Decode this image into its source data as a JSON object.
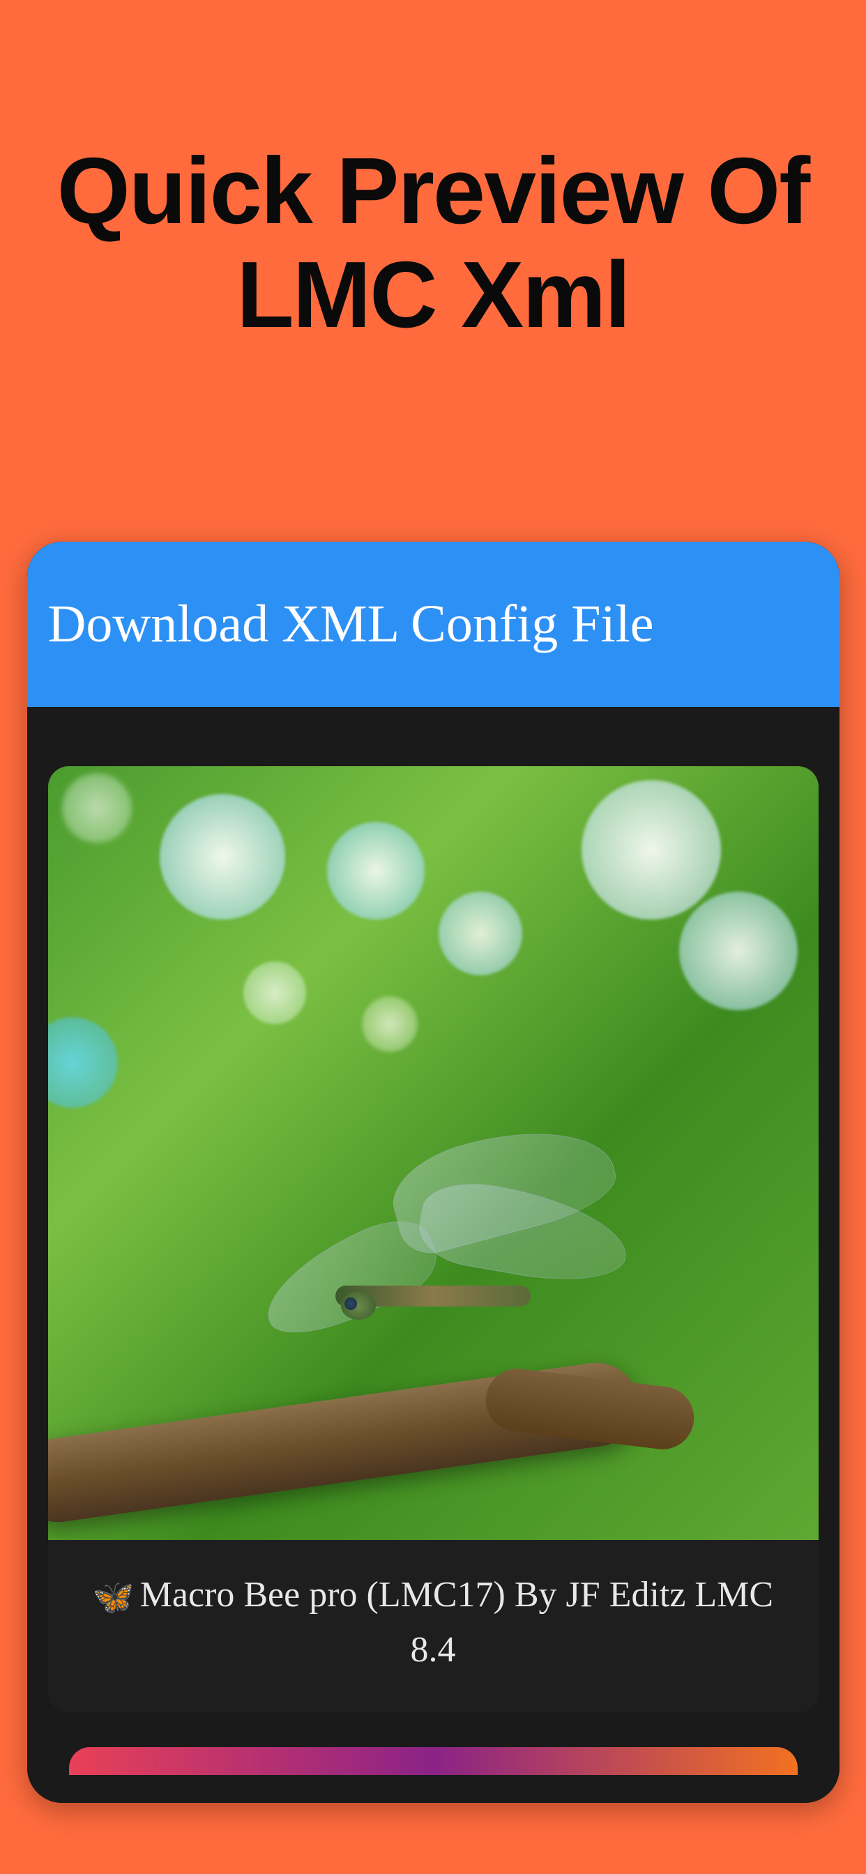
{
  "page": {
    "title": "Quick Preview Of LMC Xml"
  },
  "app": {
    "header_title": "Download XML Config File"
  },
  "item": {
    "icon_emoji": "🦋",
    "caption": "Macro Bee pro (LMC17) By JF Editz LMC 8.4"
  }
}
